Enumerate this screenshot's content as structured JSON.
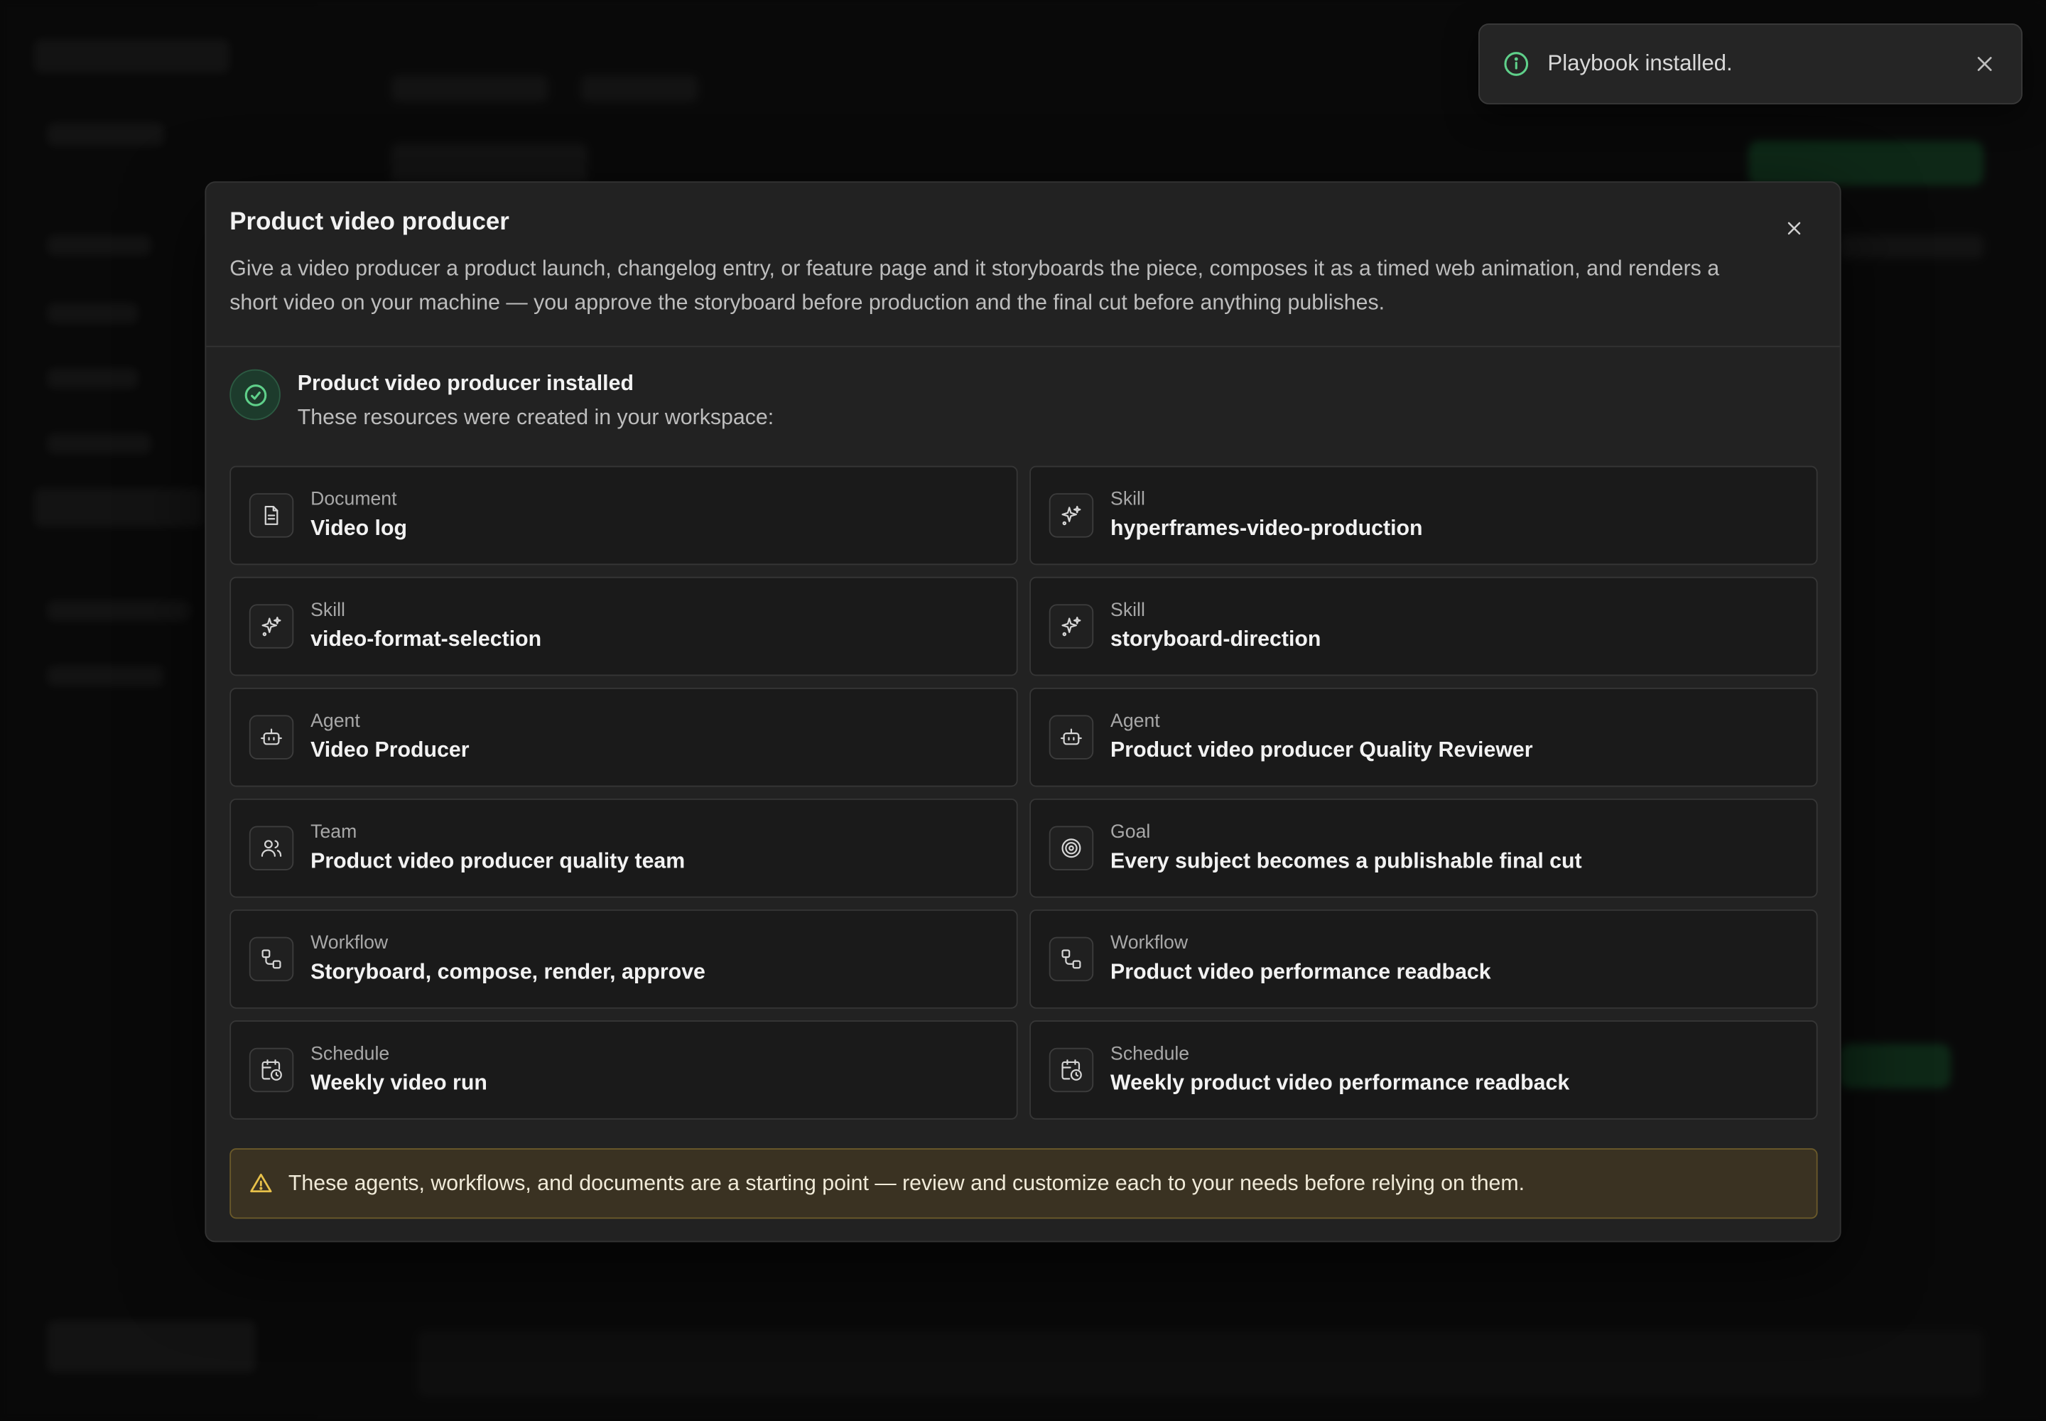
{
  "toast": {
    "message": "Playbook installed.",
    "icon": "info-icon",
    "accent": "#5fd08a"
  },
  "modal": {
    "title": "Product video producer",
    "description": "Give a video producer a product launch, changelog entry, or feature page and it storyboards the piece, composes it as a timed web animation, and renders a short video on your machine — you approve the storyboard before production and the final cut before anything publishes.",
    "installed_title": "Product video producer installed",
    "installed_subtitle": "These resources were created in your workspace:",
    "resources": [
      {
        "type": "Document",
        "name": "Video log",
        "icon": "document-icon"
      },
      {
        "type": "Skill",
        "name": "hyperframes-video-production",
        "icon": "sparkles-icon"
      },
      {
        "type": "Skill",
        "name": "video-format-selection",
        "icon": "sparkles-icon"
      },
      {
        "type": "Skill",
        "name": "storyboard-direction",
        "icon": "sparkles-icon"
      },
      {
        "type": "Agent",
        "name": "Video Producer",
        "icon": "bot-icon"
      },
      {
        "type": "Agent",
        "name": "Product video producer Quality Reviewer",
        "icon": "bot-icon"
      },
      {
        "type": "Team",
        "name": "Product video producer quality team",
        "icon": "users-icon"
      },
      {
        "type": "Goal",
        "name": "Every subject becomes a publishable final cut",
        "icon": "target-icon"
      },
      {
        "type": "Workflow",
        "name": "Storyboard, compose, render, approve",
        "icon": "workflow-icon"
      },
      {
        "type": "Workflow",
        "name": "Product video performance readback",
        "icon": "workflow-icon"
      },
      {
        "type": "Schedule",
        "name": "Weekly video run",
        "icon": "calendar-clock-icon"
      },
      {
        "type": "Schedule",
        "name": "Weekly product video performance readback",
        "icon": "calendar-clock-icon"
      }
    ],
    "warning": "These agents, workflows, and documents are a starting point — review and customize each to your needs before relying on them."
  },
  "colors": {
    "success": "#5fd08a",
    "warning": "#e8c14a",
    "background": "#141414",
    "modal": "#222222"
  }
}
